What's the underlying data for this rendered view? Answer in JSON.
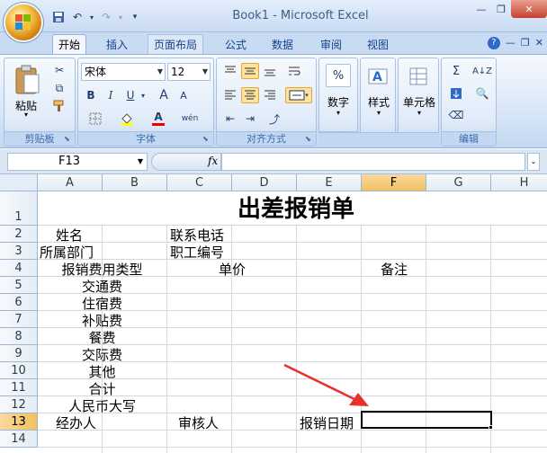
{
  "window": {
    "title": "Book1 - Microsoft Excel"
  },
  "tabs": [
    "开始",
    "插入",
    "页面布局",
    "公式",
    "数据",
    "审阅",
    "视图"
  ],
  "ribbon": {
    "clipboard": {
      "label": "剪贴板",
      "paste": "粘贴"
    },
    "font": {
      "label": "字体",
      "name": "宋体",
      "size": "12",
      "bold": "B",
      "italic": "I",
      "underline": "U",
      "grow": "A",
      "shrink": "A",
      "font_color_glyph": "A",
      "phonetic_glyph": "wén"
    },
    "alignment": {
      "label": "对齐方式"
    },
    "number": {
      "label": "数字",
      "big": "数字",
      "glyph": "%"
    },
    "styles": {
      "label": "样式",
      "big": "样式"
    },
    "cells": {
      "label": "单元格",
      "big": "单元格"
    },
    "editing": {
      "label": "编辑",
      "sigma": "Σ"
    }
  },
  "formula_bar": {
    "name_box": "F13",
    "fx": "fx",
    "content": ""
  },
  "columns": [
    "A",
    "B",
    "C",
    "D",
    "E",
    "F",
    "G",
    "H"
  ],
  "rows": [
    "1",
    "2",
    "3",
    "4",
    "5",
    "6",
    "7",
    "8",
    "9",
    "10",
    "11",
    "12",
    "13",
    "14"
  ],
  "sheet": {
    "title": "出差报销单",
    "name_label": "姓名",
    "phone_label": "联系电话",
    "dept_label": "所属部门",
    "staff_no_label": "职工编号",
    "type_header": "报销费用类型",
    "price_header": "单价",
    "note_header": "备注",
    "items": [
      "交通费",
      "住宿费",
      "补贴费",
      "餐费",
      "交际费",
      "其他",
      "合计",
      "人民币大写"
    ],
    "handler": "经办人",
    "reviewer": "审核人",
    "date_label": "报销日期"
  },
  "colors": {
    "accent": "#15428b",
    "selection_header": "#f1c15f",
    "arrow": "#e8312a"
  }
}
